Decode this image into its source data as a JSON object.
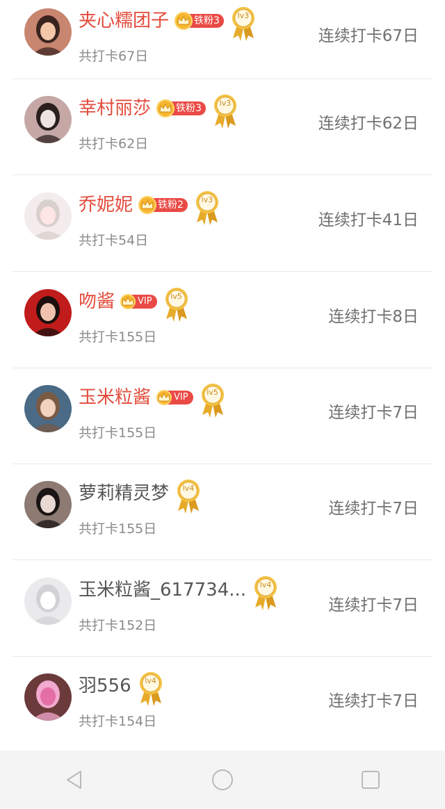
{
  "users": [
    {
      "name": "夹心糯团子",
      "name_color": "red",
      "fan": {
        "type": "tie",
        "label": "铁粉3"
      },
      "level": "lv3",
      "total": "共打卡67日",
      "streak": "连续打卡67日",
      "avatar": {
        "bg": "#c8856f",
        "accent": "#f3c7a8",
        "hair": "#3a2420"
      }
    },
    {
      "name": "幸村丽莎",
      "name_color": "red",
      "fan": {
        "type": "tie",
        "label": "铁粉3"
      },
      "level": "lv3",
      "total": "共打卡62日",
      "streak": "连续打卡62日",
      "avatar": {
        "bg": "#c5a8a6",
        "accent": "#ede3e0",
        "hair": "#2b1f1f"
      }
    },
    {
      "name": "乔妮妮",
      "name_color": "red",
      "fan": {
        "type": "tie",
        "label": "铁粉2"
      },
      "level": "lv3",
      "total": "共打卡54日",
      "streak": "连续打卡41日",
      "avatar": {
        "bg": "#f4ecec",
        "accent": "#ffe6e6",
        "hair": "#d8d0cc"
      }
    },
    {
      "name": "吻酱",
      "name_color": "red",
      "fan": {
        "type": "vip",
        "label": "VIP"
      },
      "level": "lv5",
      "total": "共打卡155日",
      "streak": "连续打卡8日",
      "avatar": {
        "bg": "#c01c1c",
        "accent": "#f0c2ad",
        "hair": "#1c0f0d"
      }
    },
    {
      "name": "玉米粒酱",
      "name_color": "red",
      "fan": {
        "type": "vip",
        "label": "VIP"
      },
      "level": "lv5",
      "total": "共打卡155日",
      "streak": "连续打卡7日",
      "avatar": {
        "bg": "#4a6a86",
        "accent": "#f1d3c2",
        "hair": "#7b5a44"
      }
    },
    {
      "name": "萝莉精灵梦",
      "name_color": "gray",
      "fan": null,
      "level": "lv4",
      "total": "共打卡155日",
      "streak": "连续打卡7日",
      "avatar": {
        "bg": "#8d7a72",
        "accent": "#e8d8d4",
        "hair": "#1a1414"
      }
    },
    {
      "name": "玉米粒酱_617734...",
      "name_color": "gray",
      "fan": null,
      "level": "lv4",
      "total": "共打卡152日",
      "streak": "连续打卡7日",
      "avatar": {
        "bg": "#eaeaec",
        "accent": "#ffffff",
        "hair": "#d2d2d6"
      }
    },
    {
      "name": "羽556",
      "name_color": "gray",
      "fan": null,
      "level": "lv4",
      "total": "共打卡154日",
      "streak": "连续打卡7日",
      "avatar": {
        "bg": "#6b3a3a",
        "accent": "#e36fa5",
        "hair": "#f1a9cf"
      }
    }
  ],
  "nav": {
    "back": "back-icon",
    "home": "home-icon",
    "recent": "recent-apps-icon"
  },
  "colors": {
    "name_red": "#e24b3b",
    "name_gray": "#555555",
    "fan_red": "#ea4a45",
    "crown_gold": "#f5b52e",
    "medal_gold": "#e6ab2a"
  }
}
